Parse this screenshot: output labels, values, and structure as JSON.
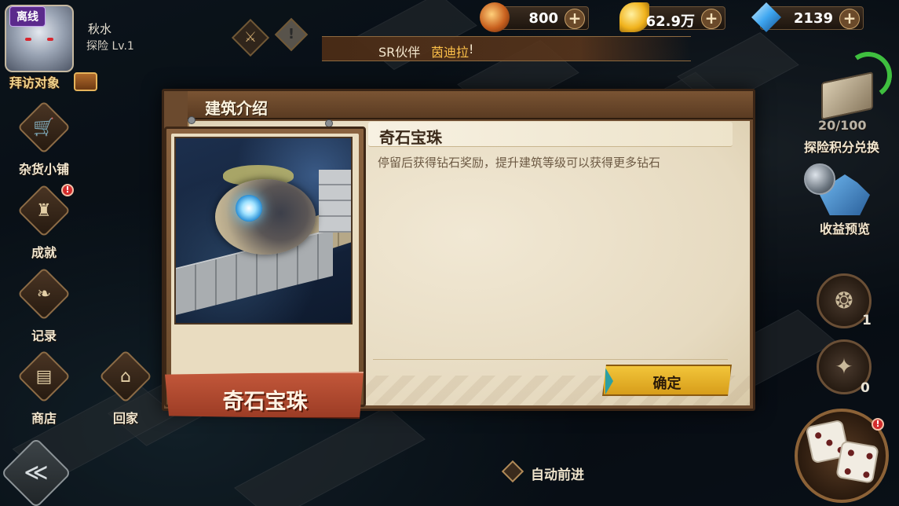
{
  "player": {
    "status_tag": "离线",
    "name": "秋水",
    "level": "探险 Lv.1",
    "visit_label": "拜访对象"
  },
  "currencies": [
    {
      "icon": "flame-rune-icon",
      "value": "800",
      "color": "#c8601e"
    },
    {
      "icon": "gold-feather-icon",
      "value": "62.9万",
      "color": "#f0b21c"
    },
    {
      "icon": "blue-diamond-icon",
      "value": "2139",
      "color": "#3ea6f0"
    }
  ],
  "notice": {
    "prefix": "SR伙伴",
    "highlight": "茵迪拉",
    "suffix": "!"
  },
  "sidebar": {
    "items": [
      {
        "key": "grocery",
        "label": "杂货小铺",
        "glyph": "🛒"
      },
      {
        "key": "achievement",
        "label": "成就",
        "glyph": "♜",
        "badge": "!"
      },
      {
        "key": "record",
        "label": "记录",
        "glyph": "❧"
      },
      {
        "key": "shop",
        "label": "商店",
        "glyph": "▤"
      },
      {
        "key": "home",
        "label": "回家",
        "glyph": "⌂"
      }
    ]
  },
  "right_panel": {
    "exploration_progress": "20/100",
    "exploration_exchange_label": "探险积分兑换",
    "income_preview_label": "收益预览",
    "item_one_count": "1",
    "item_two_count": "0",
    "dice_badge": "!"
  },
  "bottom": {
    "auto_advance_label": "自动前进"
  },
  "modal": {
    "title": "建筑介绍",
    "building_name": "奇石宝珠",
    "card_name": "奇石宝珠",
    "description": "停留后获得钻石奖励，提升建筑等级可以获得更多钻石",
    "confirm_label": "确定"
  },
  "colors": {
    "accent_gold": "#f2c53a",
    "banner_red": "#c2573a",
    "parchment": "#f1e8d4"
  }
}
